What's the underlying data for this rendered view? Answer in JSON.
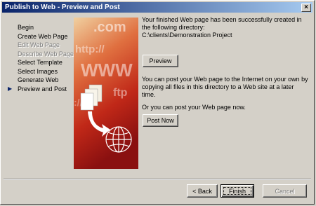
{
  "window": {
    "title": "Publish to Web - Preview and Post",
    "close_symbol": "×"
  },
  "steps": [
    {
      "label": "Begin",
      "state": "normal"
    },
    {
      "label": "Create Web Page",
      "state": "normal"
    },
    {
      "label": "Edit Web Page",
      "state": "disabled"
    },
    {
      "label": "Describe Web Page",
      "state": "disabled"
    },
    {
      "label": "Select Template",
      "state": "normal"
    },
    {
      "label": "Select Images",
      "state": "normal"
    },
    {
      "label": "Generate Web",
      "state": "normal"
    },
    {
      "label": "Preview  and Post",
      "state": "current"
    }
  ],
  "current_marker": "▶",
  "art": {
    "texts": [
      ".com",
      "http://",
      "WWW",
      "ftp",
      "://"
    ],
    "colors": {
      "light": "#f0d0a0",
      "mid": "#d04020",
      "dark": "#8a1010"
    }
  },
  "content": {
    "success_message": "Your finished Web page has been successfully created in the following directory:",
    "directory_path": "C:\\clients\\Demonstration Project",
    "copy_instructions": "You can post your Web page to the Internet on your own by copying all files in this directory to a Web site at a later time.",
    "post_now_message": "Or you can post your Web page now."
  },
  "buttons": {
    "preview": "Preview",
    "post_now": "Post Now",
    "back": "< Back",
    "finish": "Finish",
    "cancel": "Cancel"
  }
}
